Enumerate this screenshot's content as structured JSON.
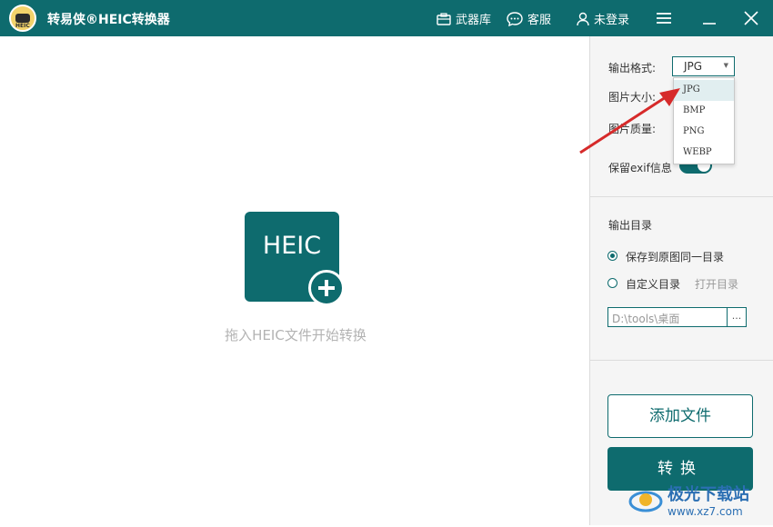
{
  "app": {
    "title": "转易侠®HEIC转换器"
  },
  "nav": {
    "weapons": "武器库",
    "service": "客服",
    "login": "未登录"
  },
  "drop": {
    "card_label": "HEIC",
    "hint": "拖入HEIC文件开始转换"
  },
  "settings": {
    "format_label": "输出格式:",
    "format_value": "JPG",
    "format_options": [
      "JPG",
      "BMP",
      "PNG",
      "WEBP"
    ],
    "size_label": "图片大小:",
    "quality_label": "图片质量:",
    "exif_label": "保留exif信息"
  },
  "output": {
    "section_label": "输出目录",
    "option_same": "保存到原图同一目录",
    "option_custom": "自定义目录",
    "open_dir": "打开目录",
    "path_value": "D:\\tools\\桌面",
    "browse_label": "..."
  },
  "actions": {
    "add_files": "添加文件",
    "convert": "转换"
  },
  "watermark": {
    "name": "极光下载站",
    "url": "www.xz7.com"
  },
  "colors": {
    "primary": "#0e6b6e",
    "arrow": "#d62a2a"
  }
}
